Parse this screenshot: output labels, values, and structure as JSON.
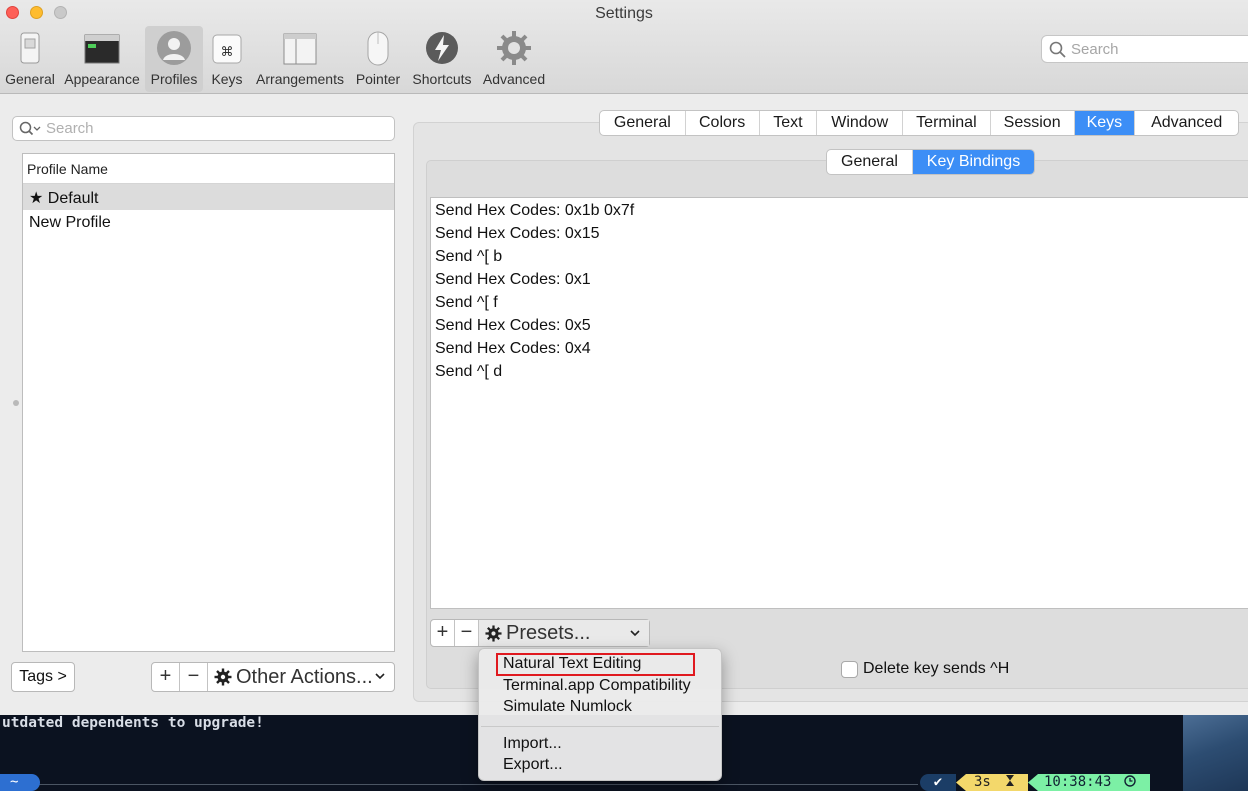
{
  "window": {
    "title": "Settings"
  },
  "toolbar": {
    "items": [
      {
        "label": "General",
        "icon": "general-switch-icon"
      },
      {
        "label": "Appearance",
        "icon": "appearance-window-icon"
      },
      {
        "label": "Profiles",
        "icon": "profiles-person-icon",
        "selected": true
      },
      {
        "label": "Keys",
        "icon": "keys-command-icon"
      },
      {
        "label": "Arrangements",
        "icon": "arrangements-window-icon"
      },
      {
        "label": "Pointer",
        "icon": "pointer-mouse-icon"
      },
      {
        "label": "Shortcuts",
        "icon": "shortcuts-bolt-icon"
      },
      {
        "label": "Advanced",
        "icon": "advanced-gear-icon"
      }
    ],
    "search_placeholder": "Search"
  },
  "profiles": {
    "search_placeholder": "Search",
    "column_header": "Profile Name",
    "rows": [
      {
        "label": "★ Default",
        "selected": true
      },
      {
        "label": "New Profile",
        "selected": false
      }
    ],
    "tags_button": "Tags >",
    "add_button": "+",
    "remove_button": "−",
    "other_actions": "Other Actions..."
  },
  "profile_tabs": [
    "General",
    "Colors",
    "Text",
    "Window",
    "Terminal",
    "Session",
    "Keys",
    "Advanced"
  ],
  "profile_tabs_active": "Keys",
  "keys_subtabs": [
    "General",
    "Key Bindings"
  ],
  "keys_subtabs_active": "Key Bindings",
  "key_bindings": [
    "Send Hex Codes: 0x1b 0x7f",
    "Send Hex Codes: 0x15",
    "Send ^[ b",
    "Send Hex Codes: 0x1",
    "Send ^[ f",
    "Send Hex Codes: 0x5",
    "Send Hex Codes: 0x4",
    "Send ^[ d"
  ],
  "bindings_controls": {
    "add": "+",
    "remove": "−",
    "presets": "Presets..."
  },
  "delete_key_option": {
    "label": "Delete key sends ^H",
    "checked": false
  },
  "presets_menu": {
    "items": [
      "Natural Text Editing",
      "Terminal.app Compatibility",
      "Simulate Numlock"
    ],
    "items_after_separator": [
      "Import...",
      "Export..."
    ],
    "highlighted": "Natural Text Editing"
  },
  "terminal": {
    "output_line": "utdated dependents to upgrade!",
    "prompt_dir": "~",
    "status_ok": "✔",
    "duration": "3s",
    "duration_icon": "hourglass-icon",
    "time": "10:38:43",
    "time_icon": "clock-icon"
  },
  "colors": {
    "accent": "#3c8ef6",
    "highlight_box": "#e0191f",
    "terminal_bg": "#0b1220",
    "status_yellow": "#f3d86b",
    "status_green": "#7cf0a5"
  }
}
